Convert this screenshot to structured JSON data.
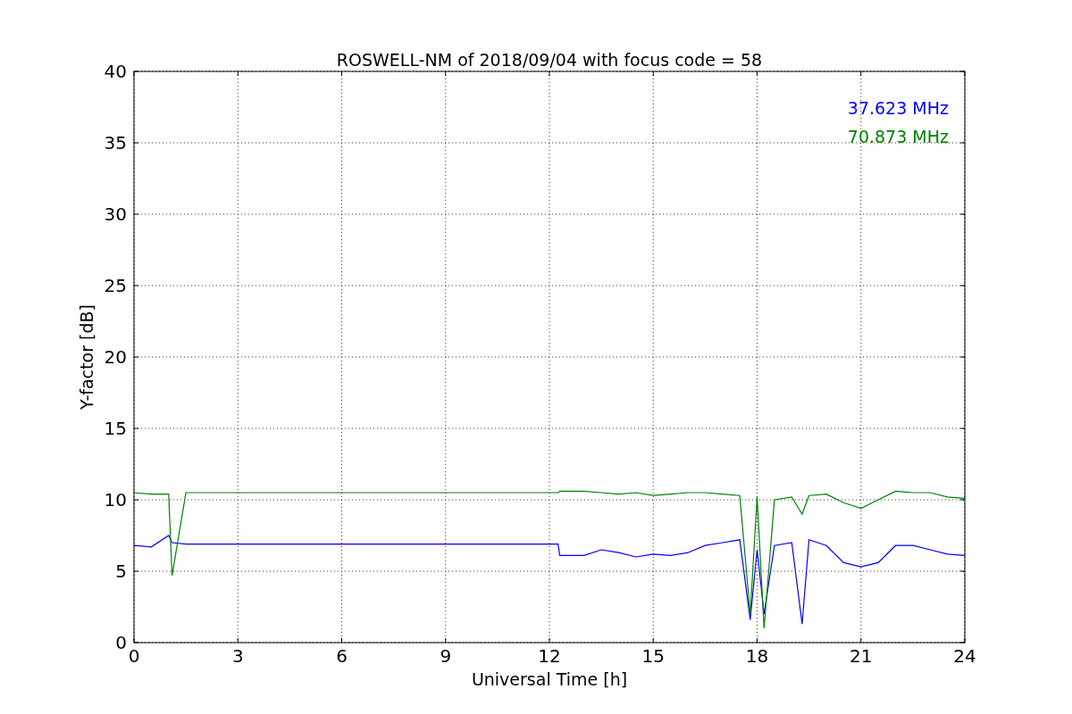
{
  "chart_data": {
    "type": "line",
    "title": "ROSWELL-NM of 2018/09/04 with focus code = 58",
    "xlabel": "Universal Time [h]",
    "ylabel": "Y-factor [dB]",
    "x": [
      0,
      0.5,
      1,
      1.1,
      1.5,
      3,
      6,
      9,
      12.25,
      12.3,
      12.5,
      13,
      13.5,
      14,
      14.5,
      15,
      15.5,
      16,
      16.5,
      17,
      17.5,
      17.8,
      18,
      18.2,
      18.5,
      19,
      19.3,
      19.5,
      20,
      20.5,
      21,
      21.5,
      22,
      22.5,
      23,
      23.5,
      24
    ],
    "series": [
      {
        "name": "37.623 MHz",
        "color": "#0000ff",
        "values": [
          6.8,
          6.7,
          7.5,
          7.0,
          6.9,
          6.9,
          6.9,
          6.9,
          6.9,
          6.1,
          6.1,
          6.1,
          6.5,
          6.3,
          6.0,
          6.2,
          6.1,
          6.3,
          6.8,
          7.0,
          7.2,
          1.6,
          6.5,
          2.0,
          6.8,
          7.0,
          1.3,
          7.2,
          6.8,
          5.6,
          5.3,
          5.6,
          6.8,
          6.8,
          6.5,
          6.2,
          6.1
        ]
      },
      {
        "name": "70.873 MHz",
        "color": "#008000",
        "values": [
          10.5,
          10.4,
          10.4,
          4.7,
          10.5,
          10.5,
          10.5,
          10.5,
          10.5,
          10.6,
          10.6,
          10.6,
          10.5,
          10.4,
          10.5,
          10.3,
          10.4,
          10.5,
          10.5,
          10.4,
          10.3,
          2.0,
          10.2,
          1.0,
          10.0,
          10.2,
          9.0,
          10.3,
          10.4,
          9.8,
          9.4,
          10.0,
          10.6,
          10.5,
          10.5,
          10.2,
          10.1
        ]
      }
    ],
    "grid": true,
    "xlim": [
      0,
      24
    ],
    "ylim": [
      0,
      40
    ],
    "xticks": [
      0,
      3,
      6,
      9,
      12,
      15,
      18,
      21,
      24
    ],
    "yticks": [
      0,
      5,
      10,
      15,
      20,
      25,
      30,
      35,
      40
    ]
  }
}
